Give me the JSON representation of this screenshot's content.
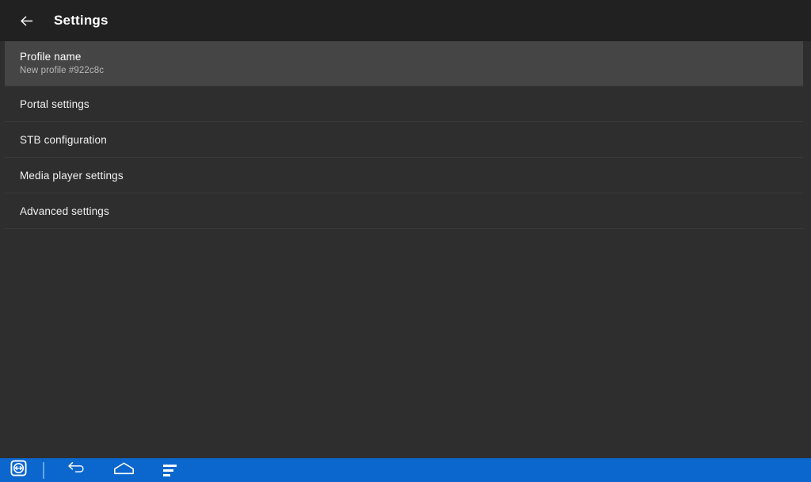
{
  "appbar": {
    "back_icon": "arrow-left-icon",
    "title": "Settings"
  },
  "settings_list": {
    "profile": {
      "title": "Profile name",
      "subtitle": "New profile #922c8c"
    },
    "items": [
      {
        "label": "Portal settings"
      },
      {
        "label": "STB configuration"
      },
      {
        "label": "Media player settings"
      },
      {
        "label": "Advanced settings"
      }
    ]
  },
  "navbar": {
    "teamviewer_icon": "teamviewer-icon",
    "back_icon": "android-back-icon",
    "home_icon": "android-home-icon",
    "recents_icon": "android-recents-icon"
  },
  "colors": {
    "appbar_bg": "#212121",
    "page_bg": "#2e2e2e",
    "row_selected_bg": "#454545",
    "divider": "#3a3a3a",
    "navbar_bg": "#0b67ce",
    "text_primary": "#f2f2f2",
    "text_secondary": "#b8b8b8"
  }
}
